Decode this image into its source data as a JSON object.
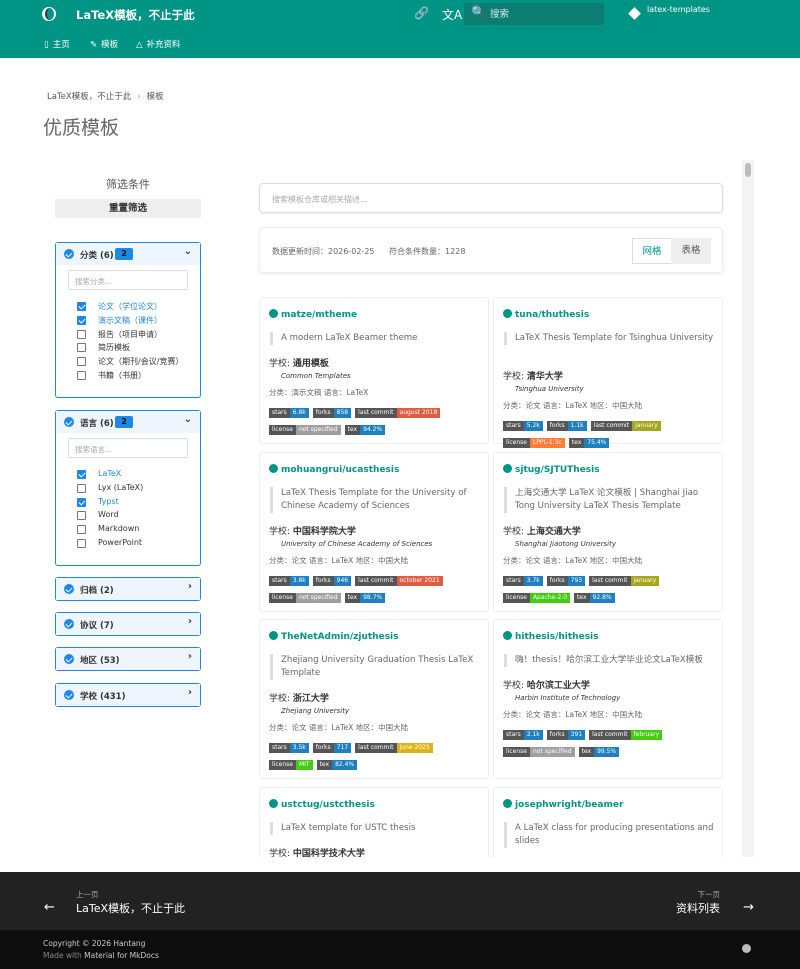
{
  "header": {
    "site_title": "LaTeX模板，不止于此",
    "search_placeholder": "搜索",
    "repo_name": "latex-templates",
    "tabs": [
      {
        "label": "主页",
        "icon": "file-icon"
      },
      {
        "label": "模板",
        "icon": "brush-icon"
      },
      {
        "label": "补充资料",
        "icon": "shapes-icon"
      }
    ]
  },
  "breadcrumb": {
    "items": [
      "LaTeX模板，不止于此",
      "模板"
    ],
    "separator": "›"
  },
  "page_title": "优质模板",
  "filters": {
    "title": "筛选条件",
    "reset_label": "重置筛选",
    "groups": [
      {
        "label": "分类 (6)",
        "selected": "2",
        "search_placeholder": "搜索分类...",
        "expanded": true,
        "options": [
          {
            "label": "论文（学位论文）",
            "checked": true
          },
          {
            "label": "演示文稿（课件）",
            "checked": true
          },
          {
            "label": "报告（项目申请）",
            "checked": false
          },
          {
            "label": "简历模板",
            "checked": false
          },
          {
            "label": "论文（期刊/会议/竞赛）",
            "checked": false
          },
          {
            "label": "书籍（书册）",
            "checked": false
          }
        ]
      },
      {
        "label": "语言 (6)",
        "selected": "2",
        "search_placeholder": "搜索语言...",
        "expanded": true,
        "options": [
          {
            "label": "LaTeX",
            "checked": true
          },
          {
            "label": "Lyx (LaTeX)",
            "checked": false
          },
          {
            "label": "Typst",
            "checked": true
          },
          {
            "label": "Word",
            "checked": false
          },
          {
            "label": "Markdown",
            "checked": false
          },
          {
            "label": "PowerPoint",
            "checked": false
          }
        ]
      },
      {
        "label": "归档 (2)",
        "expanded": false
      },
      {
        "label": "协议 (7)",
        "expanded": false
      },
      {
        "label": "地区 (53)",
        "expanded": false
      },
      {
        "label": "学校 (431)",
        "expanded": false
      }
    ]
  },
  "main": {
    "search_placeholder": "搜索模板仓库或相关描述...",
    "stats": {
      "updated_label": "数据更新时间：",
      "updated": "2026-02-25",
      "count_label": "符合条件数量：",
      "count": "1228"
    },
    "view_toggle": {
      "grid": "网格",
      "table": "表格",
      "active": "grid"
    }
  },
  "cards": [
    {
      "name": "matze/mtheme",
      "desc": "A modern LaTeX Beamer theme",
      "school": "通用模板",
      "school_en": "Common Templates",
      "meta": "分类：演示文稿   语言：LaTeX",
      "badges": [
        [
          "stars",
          "6.8k",
          "#1e7fc1"
        ],
        [
          "forks",
          "858",
          "#1e7fc1"
        ],
        [
          "last commit",
          "august 2018",
          "#e05d44"
        ],
        [
          "license",
          "not specified",
          "#9f9f9f"
        ],
        [
          "tex",
          "94.2%",
          "#1e7fc1"
        ]
      ]
    },
    {
      "name": "tuna/thuthesis",
      "desc": "LaTeX Thesis Template for Tsinghua University",
      "school": "清华大学",
      "school_en": "Tsinghua University",
      "meta": "分类：论文   语言：LaTeX   地区：中国大陆",
      "badges": [
        [
          "stars",
          "5.2k",
          "#1e7fc1"
        ],
        [
          "forks",
          "1.1k",
          "#1e7fc1"
        ],
        [
          "last commit",
          "january",
          "#a4a61d"
        ],
        [
          "license",
          "LPPL-1.3c",
          "#fe7d37"
        ],
        [
          "tex",
          "75.4%",
          "#1e7fc1"
        ]
      ]
    },
    {
      "name": "mohuangrui/ucasthesis",
      "desc": "LaTeX Thesis Template for the University of Chinese Academy of Sciences",
      "school": "中国科学院大学",
      "school_en": "University of Chinese Academy of Sciences",
      "meta": "分类：论文   语言：LaTeX   地区：中国大陆",
      "badges": [
        [
          "stars",
          "3.8k",
          "#1e7fc1"
        ],
        [
          "forks",
          "946",
          "#1e7fc1"
        ],
        [
          "last commit",
          "october 2021",
          "#e05d44"
        ],
        [
          "license",
          "not specified",
          "#9f9f9f"
        ],
        [
          "tex",
          "98.7%",
          "#1e7fc1"
        ]
      ]
    },
    {
      "name": "sjtug/SJTUThesis",
      "desc": "上海交通大学 LaTeX 论文模板 | Shanghai Jiao Tong University LaTeX Thesis Template",
      "school": "上海交通大学",
      "school_en": "Shanghai Jiaotong University",
      "meta": "分类：论文   语言：LaTeX   地区：中国大陆",
      "badges": [
        [
          "stars",
          "3.7k",
          "#1e7fc1"
        ],
        [
          "forks",
          "793",
          "#1e7fc1"
        ],
        [
          "last commit",
          "january",
          "#a4a61d"
        ],
        [
          "license",
          "Apache-2.0",
          "#4c1"
        ],
        [
          "tex",
          "92.8%",
          "#1e7fc1"
        ]
      ]
    },
    {
      "name": "TheNetAdmin/zjuthesis",
      "desc": "Zhejiang University Graduation Thesis LaTeX Template",
      "school": "浙江大学",
      "school_en": "Zhejiang University",
      "meta": "分类：论文   语言：LaTeX   地区：中国大陆",
      "badges": [
        [
          "stars",
          "3.5k",
          "#1e7fc1"
        ],
        [
          "forks",
          "717",
          "#1e7fc1"
        ],
        [
          "last commit",
          "june 2025",
          "#dfb317"
        ],
        [
          "license",
          "MIT",
          "#4c1"
        ],
        [
          "tex",
          "82.4%",
          "#1e7fc1"
        ]
      ]
    },
    {
      "name": "hithesis/hithesis",
      "desc": "嗨！thesis！哈尔滨工业大学毕业论文LaTeX模板",
      "school": "哈尔滨工业大学",
      "school_en": "Harbin Institute of Technology",
      "meta": "分类：论文   语言：LaTeX   地区：中国大陆",
      "badges": [
        [
          "stars",
          "2.1k",
          "#1e7fc1"
        ],
        [
          "forks",
          "391",
          "#1e7fc1"
        ],
        [
          "last commit",
          "february",
          "#4c1"
        ],
        [
          "license",
          "not specified",
          "#9f9f9f"
        ],
        [
          "tex",
          "99.5%",
          "#1e7fc1"
        ]
      ]
    },
    {
      "name": "ustctug/ustcthesis",
      "desc": "LaTeX template for USTC thesis",
      "school": "中国科学技术大学",
      "school_en": "",
      "meta": "",
      "badges": []
    },
    {
      "name": "josephwright/beamer",
      "desc": "A LaTeX class for producing presentations and slides",
      "school": "",
      "school_en": "",
      "meta": "",
      "badges": []
    }
  ],
  "footer": {
    "prev_label": "上一页",
    "prev_title": "LaTeX模板，不止于此",
    "next_label": "下一页",
    "next_title": "资料列表",
    "copyright": "Copyright © 2026 Hantang",
    "made_with_prefix": "Made with ",
    "made_with_link": "Material for MkDocs"
  }
}
